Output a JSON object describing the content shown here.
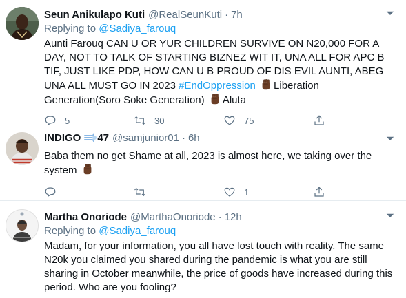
{
  "tweets": [
    {
      "name": "Seun Anikulapo Kuti",
      "handle": "@RealSeunKuti",
      "time": "7h",
      "replying_label": "Replying to",
      "replying_to": "@Sadiya_farouq",
      "text_1": "Aunti Farouq CAN U OR YUR CHILDREN SURVIVE ON N20,000 FOR A DAY, NOT TO TALK OF STARTING BIZNEZ WIT IT, UNA ALL FOR APC B TIF, JUST LIKE PDP, HOW CAN U B PROUD OF DIS EVIL AUNTI, ABEG UNA ALL MUST GO IN 2023",
      "hashtag": "#EndOppression",
      "text_2": "Liberation Generation(Soro Soke Generation)",
      "text_3": "Aluta",
      "replies": "5",
      "retweets": "30",
      "likes": "75"
    },
    {
      "name": "INDIGO",
      "name_suffix": "47",
      "handle": "@samjunior01",
      "time": "6h",
      "text_1": "Baba them no get Shame at all, 2023 is almost here, we taking over the system",
      "replies": "",
      "retweets": "",
      "likes": "1"
    },
    {
      "name": "Martha Onoriode",
      "handle": "@MarthaOnoriode",
      "time": "12h",
      "replying_label": "Replying to",
      "replying_to": "@Sadiya_farouq",
      "text_1": "Madam, for your information, you all have lost touch with reality. The same N20k you claimed you shared during the pandemic is what you are still sharing in October meanwhile, the price of goods have increased during this period. Who are you fooling?"
    }
  ],
  "icons": {
    "more": "more-icon",
    "reply": "reply-icon",
    "retweet": "retweet-icon",
    "like": "heart-icon",
    "share": "share-icon",
    "fist": "raised-fist-emoji",
    "dash": "dash-emoji"
  },
  "colors": {
    "accent": "#1da1f2",
    "secondary_text": "#5b7083",
    "divider": "#e6ecf0",
    "fist": "#6b3e26"
  }
}
